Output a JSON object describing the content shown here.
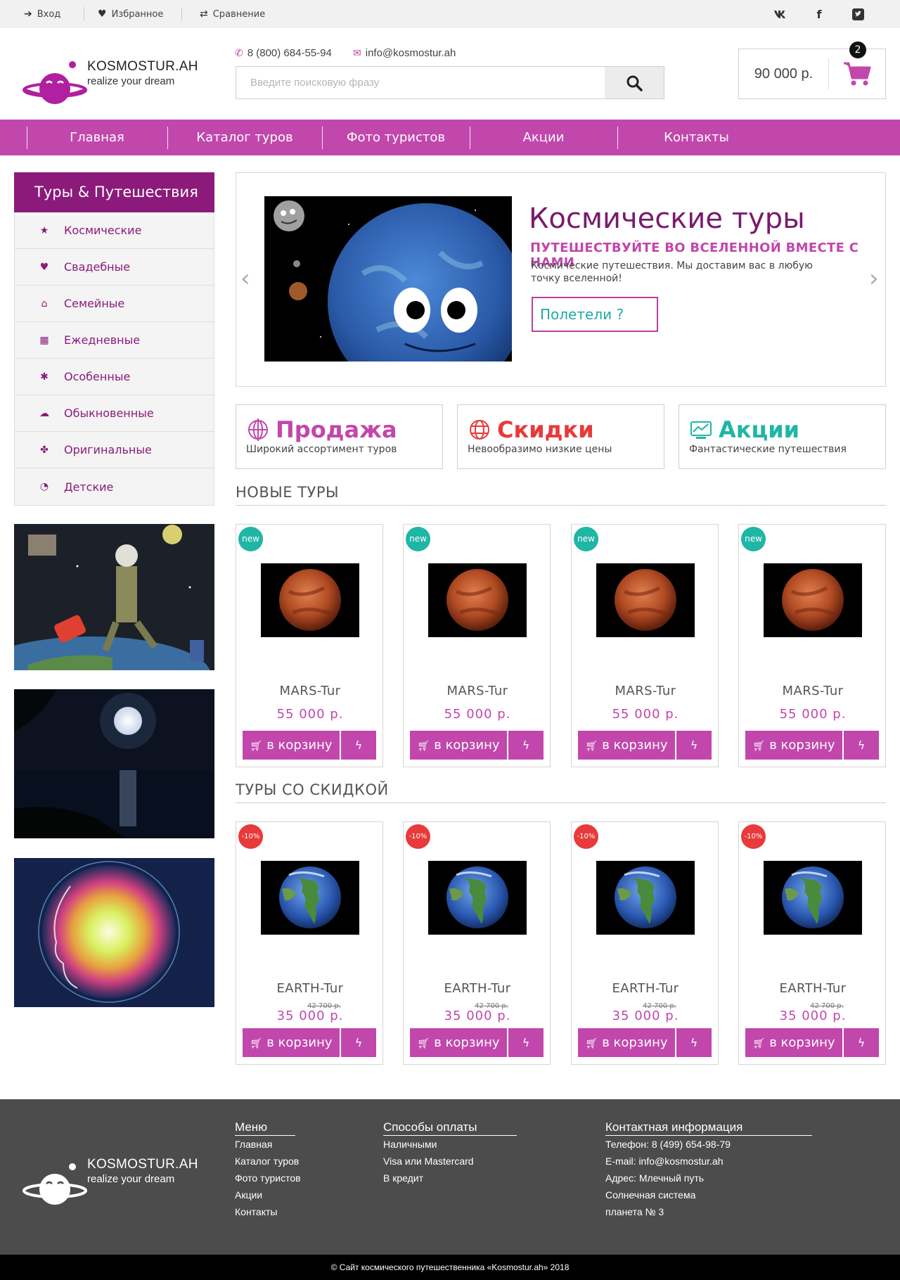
{
  "topbar": {
    "login": "Вход",
    "favorites": "Избранное",
    "compare": "Сравнение",
    "social": [
      "vk-icon",
      "facebook-icon",
      "twitter-icon"
    ]
  },
  "brand": {
    "name": "KOSMOSTUR.AH",
    "tagline": "realize your dream",
    "accent": "#c247ac",
    "dark_accent": "#8c1a7b",
    "teal": "#1fb6a6",
    "sale_red": "#e83a3a"
  },
  "header": {
    "phone": "8 (800) 684-55-94",
    "email": "info@kosmostur.ah",
    "search_placeholder": "Введите поисковую фразу",
    "cart_total": "90 000 р.",
    "cart_count": "2"
  },
  "nav": [
    "Главная",
    "Каталог туров",
    "Фото туристов",
    "Акции",
    "Контакты"
  ],
  "sidebar": {
    "title": "Туры & Путешествия",
    "items": [
      {
        "label": "Космические",
        "icon": "star-icon"
      },
      {
        "label": "Свадебные",
        "icon": "heart-icon"
      },
      {
        "label": "Семейные",
        "icon": "home-icon"
      },
      {
        "label": "Ежедневные",
        "icon": "calendar-icon"
      },
      {
        "label": "Особенные",
        "icon": "sparkle-icon"
      },
      {
        "label": "Обыкновенные",
        "icon": "cloud-icon"
      },
      {
        "label": "Оригинальные",
        "icon": "flower-icon"
      },
      {
        "label": "Детские",
        "icon": "spiral-icon"
      }
    ]
  },
  "slider": {
    "title": "Космические туры",
    "subtitle": "ПУТЕШЕСТВУЙТЕ ВО ВСЕЛЕННОЙ ВМЕСТЕ С НАМИ",
    "text": "Космические путешествия. Мы доставим вас в любую точку вселенной!",
    "button": "Полетели ?"
  },
  "promos": [
    {
      "title": "Продажа",
      "desc": "Широкий ассортимент туров",
      "color": "#c247ac",
      "icon": "globe-icon"
    },
    {
      "title": "Скидки",
      "desc": "Невообразимо низкие цены",
      "color": "#e83a3a",
      "icon": "globe-icon"
    },
    {
      "title": "Акции",
      "desc": "Фантастические путешествия",
      "color": "#1fb6a6",
      "icon": "computer-icon"
    }
  ],
  "new_tours": {
    "title": "НОВЫЕ ТУРЫ",
    "badge": "new",
    "items": [
      {
        "name": "MARS-Tur",
        "price": "55 000 р."
      },
      {
        "name": "MARS-Tur",
        "price": "55 000 р."
      },
      {
        "name": "MARS-Tur",
        "price": "55 000 р."
      },
      {
        "name": "MARS-Tur",
        "price": "55 000 р."
      }
    ]
  },
  "sale_tours": {
    "title": "ТУРЫ СО СКИДКОЙ",
    "badge": "-10%",
    "items": [
      {
        "name": "EARTH-Tur",
        "old_price": "42 700 р.",
        "price": "35 000 р."
      },
      {
        "name": "EARTH-Tur",
        "old_price": "42 700 р.",
        "price": "35 000 р."
      },
      {
        "name": "EARTH-Tur",
        "old_price": "42 700 р.",
        "price": "35 000 р."
      },
      {
        "name": "EARTH-Tur",
        "old_price": "42 700 р.",
        "price": "35 000 р."
      }
    ]
  },
  "buy_label": "в корзину",
  "footer": {
    "menu_title": "Меню",
    "menu": [
      "Главная",
      "Каталог туров",
      "Фото туристов",
      "Акции",
      "Контакты"
    ],
    "pay_title": "Способы оплаты",
    "pay": [
      "Наличными",
      "Visa или Mastercard",
      "В кредит"
    ],
    "contact_title": "Контактная информация",
    "contact": [
      "Телефон: 8 (499) 654-98-79",
      "E-mail: info@kosmostur.ah",
      "Адрес: Млечный путь",
      "Солнечная система",
      "планета № 3"
    ],
    "copyright": "© Сайт космического путешественника «Kosmostur.ah» 2018"
  }
}
